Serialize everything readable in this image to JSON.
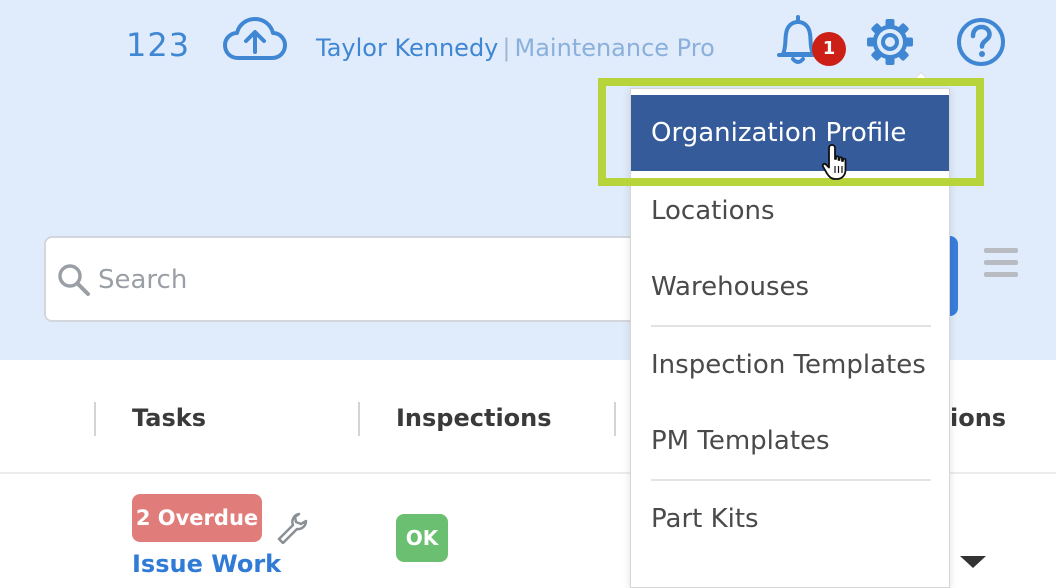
{
  "header": {
    "count": "123",
    "user_name": "Taylor Kennedy",
    "separator": "|",
    "role": "Maintenance Pro",
    "notification_count": "1"
  },
  "icons": {
    "upload": "cloud-upload-icon",
    "notifications": "bell-icon",
    "settings": "gear-icon",
    "help": "help-icon",
    "search": "search-icon",
    "menu": "hamburger-icon",
    "wrench": "wrench-icon"
  },
  "search": {
    "placeholder": "Search"
  },
  "table": {
    "columns": [
      "Tasks",
      "Inspections",
      "ions"
    ],
    "row": {
      "overdue_label": "2 Overdue",
      "issue_link": "Issue Work",
      "inspection_status": "OK"
    }
  },
  "settings_menu": {
    "items": [
      {
        "label": "Organization Profile",
        "active": true
      },
      {
        "label": "Locations",
        "active": false
      },
      {
        "label": "Warehouses",
        "active": false
      },
      {
        "label": "Inspection Templates",
        "active": false
      },
      {
        "label": "PM Templates",
        "active": false
      },
      {
        "label": "Part Kits",
        "active": false
      }
    ]
  },
  "colors": {
    "primary_blue": "#3f86d3",
    "header_bg": "#e0ecfb",
    "menu_active_bg": "#355b9a",
    "highlight_frame": "#b7d43a",
    "badge_red": "#cc1f16",
    "overdue_bg": "#e07d7b",
    "ok_bg": "#6ac070"
  }
}
